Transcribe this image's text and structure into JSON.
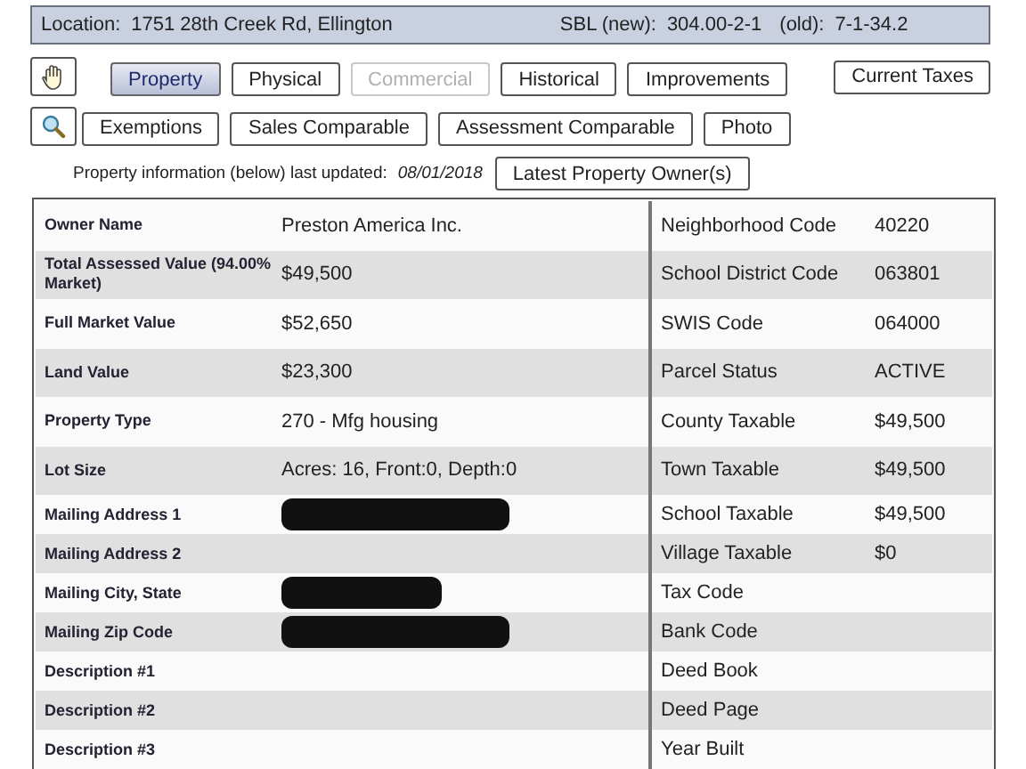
{
  "header": {
    "location_label": "Location:",
    "location": "1751 28th Creek Rd, Ellington",
    "sbl_new_label": "SBL (new):",
    "sbl_new": "304.00-2-1",
    "sbl_old_label": "(old):",
    "sbl_old": "7-1-34.2"
  },
  "tabs_row_1": [
    {
      "label": "Property",
      "selected": true,
      "disabled": false
    },
    {
      "label": "Physical",
      "selected": false,
      "disabled": false
    },
    {
      "label": "Commercial",
      "selected": false,
      "disabled": true
    },
    {
      "label": "Historical",
      "selected": false,
      "disabled": false
    },
    {
      "label": "Improvements",
      "selected": false,
      "disabled": false
    }
  ],
  "current_taxes_button": "Current Taxes",
  "tabs_row_2": [
    {
      "label": "Exemptions",
      "selected": false,
      "disabled": false
    },
    {
      "label": "Sales Comparable",
      "selected": false,
      "disabled": false
    },
    {
      "label": "Assessment Comparable",
      "selected": false,
      "disabled": false
    },
    {
      "label": "Photo",
      "selected": false,
      "disabled": false
    }
  ],
  "updated": {
    "label": "Property information (below) last updated:",
    "date": "08/01/2018"
  },
  "latest_owner_button": "Latest Property Owner(s)",
  "rows": [
    {
      "label": "Owner Name",
      "value": "Preston America Inc.",
      "redacted": false,
      "right_label": "Neighborhood Code",
      "right_value": "40220"
    },
    {
      "label": "Total Assessed Value (94.00% Market)",
      "value": "$49,500",
      "redacted": false,
      "right_label": "School District Code",
      "right_value": "063801"
    },
    {
      "label": "Full Market Value",
      "value": "$52,650",
      "redacted": false,
      "right_label": "SWIS Code",
      "right_value": "064000"
    },
    {
      "label": "Land Value",
      "value": "$23,300",
      "redacted": false,
      "right_label": "Parcel Status",
      "right_value": "ACTIVE"
    },
    {
      "label": "Property Type",
      "value": "270 - Mfg housing",
      "redacted": false,
      "right_label": "County Taxable",
      "right_value": "$49,500"
    },
    {
      "label": "Lot Size",
      "value": "Acres: 16, Front:0, Depth:0",
      "redacted": false,
      "right_label": "Town Taxable",
      "right_value": "$49,500"
    },
    {
      "label": "Mailing Address 1",
      "redacted": true,
      "right_label": "School Taxable",
      "right_value": "$49,500"
    },
    {
      "label": "Mailing Address 2",
      "redacted": false,
      "right_label": "Village Taxable",
      "right_value": "$0"
    },
    {
      "label": "Mailing City, State",
      "redacted": true,
      "right_label": "Tax Code"
    },
    {
      "label": "Mailing Zip Code",
      "redacted": true,
      "right_label": "Bank Code"
    },
    {
      "label": "Description #1",
      "redacted": false,
      "right_label": "Deed Book"
    },
    {
      "label": "Description #2",
      "redacted": false,
      "right_label": "Deed Page"
    },
    {
      "label": "Description #3",
      "redacted": false,
      "right_label": "Year Built"
    }
  ]
}
